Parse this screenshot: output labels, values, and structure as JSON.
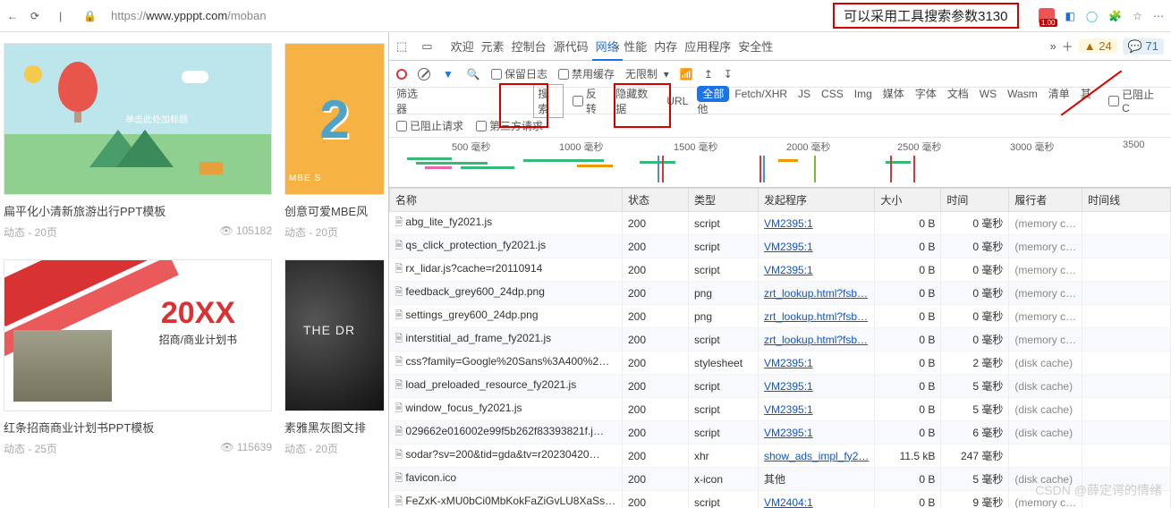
{
  "browser": {
    "url_prefix": "https://",
    "url_host": "www.ypppt.com",
    "url_path": "/moban",
    "annotation": "可以采用工具搜索参数3130",
    "ext_badge": "1.00"
  },
  "cards": [
    {
      "title": "扁平化小清新旅游出行PPT模板",
      "pages": "动态 - 20页",
      "views": "105182",
      "thumb_text": "单击此处加标题"
    },
    {
      "title": "创意可爱MBE风",
      "pages": "动态 - 20页",
      "views": "",
      "thumb_num": "2",
      "thumb_mbe": "MBE S"
    },
    {
      "title": "红条招商商业计划书PPT模板",
      "pages": "动态 - 25页",
      "views": "115639",
      "thumb_year": "20XX",
      "thumb_sub": "招商/商业计划书"
    },
    {
      "title": "素雅黑灰图文排",
      "pages": "动态 - 20页",
      "views": "",
      "thumb_dr": "THE DR"
    }
  ],
  "devtools": {
    "tabs": [
      "欢迎",
      "元素",
      "控制台",
      "源代码",
      "网络",
      "性能",
      "内存",
      "应用程序",
      "安全性"
    ],
    "active_tab": "网络",
    "warn_count": "24",
    "info_count": "71",
    "toolbar": {
      "preserve_log": "保留日志",
      "disable_cache": "禁用缓存",
      "throttle": "无限制"
    },
    "filter": {
      "label": "筛选器",
      "search_btn": "搜索",
      "invert": "反转",
      "hide_data": "隐藏数据",
      "url": "URL",
      "pills": [
        "全部",
        "Fetch/XHR",
        "JS",
        "CSS",
        "Img",
        "媒体",
        "字体",
        "文档",
        "WS",
        "Wasm",
        "清单",
        "其他"
      ],
      "blocked_c": "已阻止 C"
    },
    "block_row": {
      "blocked_req": "已阻止请求",
      "third_party": "第三方请求"
    },
    "timeline_ticks": [
      {
        "label": "500 毫秒",
        "pos": 70
      },
      {
        "label": "1000 毫秒",
        "pos": 190
      },
      {
        "label": "1500 毫秒",
        "pos": 318
      },
      {
        "label": "2000 毫秒",
        "pos": 444
      },
      {
        "label": "2500 毫秒",
        "pos": 568
      },
      {
        "label": "3000 毫秒",
        "pos": 694
      },
      {
        "label": "3500",
        "pos": 820
      }
    ],
    "columns": [
      "名称",
      "状态",
      "类型",
      "发起程序",
      "大小",
      "时间",
      "履行者",
      "时间线"
    ],
    "rows": [
      {
        "name": "abg_lite_fy2021.js",
        "status": "200",
        "type": "script",
        "initiator": "VM2395:1",
        "link": true,
        "size": "0 B",
        "time": "0 毫秒",
        "cache": "(memory c…"
      },
      {
        "name": "qs_click_protection_fy2021.js",
        "status": "200",
        "type": "script",
        "initiator": "VM2395:1",
        "link": true,
        "size": "0 B",
        "time": "0 毫秒",
        "cache": "(memory c…"
      },
      {
        "name": "rx_lidar.js?cache=r20110914",
        "status": "200",
        "type": "script",
        "initiator": "VM2395:1",
        "link": true,
        "size": "0 B",
        "time": "0 毫秒",
        "cache": "(memory c…"
      },
      {
        "name": "feedback_grey600_24dp.png",
        "status": "200",
        "type": "png",
        "initiator": "zrt_lookup.html?fsb…",
        "link": true,
        "size": "0 B",
        "time": "0 毫秒",
        "cache": "(memory c…"
      },
      {
        "name": "settings_grey600_24dp.png",
        "status": "200",
        "type": "png",
        "initiator": "zrt_lookup.html?fsb…",
        "link": true,
        "size": "0 B",
        "time": "0 毫秒",
        "cache": "(memory c…"
      },
      {
        "name": "interstitial_ad_frame_fy2021.js",
        "status": "200",
        "type": "script",
        "initiator": "zrt_lookup.html?fsb…",
        "link": true,
        "size": "0 B",
        "time": "0 毫秒",
        "cache": "(memory c…"
      },
      {
        "name": "css?family=Google%20Sans%3A400%2…",
        "status": "200",
        "type": "stylesheet",
        "initiator": "VM2395:1",
        "link": true,
        "size": "0 B",
        "time": "2 毫秒",
        "cache": "(disk cache)"
      },
      {
        "name": "load_preloaded_resource_fy2021.js",
        "status": "200",
        "type": "script",
        "initiator": "VM2395:1",
        "link": true,
        "size": "0 B",
        "time": "5 毫秒",
        "cache": "(disk cache)"
      },
      {
        "name": "window_focus_fy2021.js",
        "status": "200",
        "type": "script",
        "initiator": "VM2395:1",
        "link": true,
        "size": "0 B",
        "time": "5 毫秒",
        "cache": "(disk cache)"
      },
      {
        "name": "029662e016002e99f5b262f83393821f.j…",
        "status": "200",
        "type": "script",
        "initiator": "VM2395:1",
        "link": true,
        "size": "0 B",
        "time": "6 毫秒",
        "cache": "(disk cache)"
      },
      {
        "name": "sodar?sv=200&tid=gda&tv=r20230420…",
        "status": "200",
        "type": "xhr",
        "initiator": "show_ads_impl_fy2…",
        "link": true,
        "size": "11.5 kB",
        "time": "247 毫秒",
        "cache": ""
      },
      {
        "name": "favicon.ico",
        "status": "200",
        "type": "x-icon",
        "initiator": "其他",
        "link": false,
        "size": "0 B",
        "time": "5 毫秒",
        "cache": "(disk cache)"
      },
      {
        "name": "FeZxK-xMU0bCi0MbKokFaZiGvLU8XaSs…",
        "status": "200",
        "type": "script",
        "initiator": "VM2404:1",
        "link": true,
        "size": "0 B",
        "time": "9 毫秒",
        "cache": "(memory c…"
      }
    ]
  },
  "watermark": "CSDN @薛定谔的情绪"
}
